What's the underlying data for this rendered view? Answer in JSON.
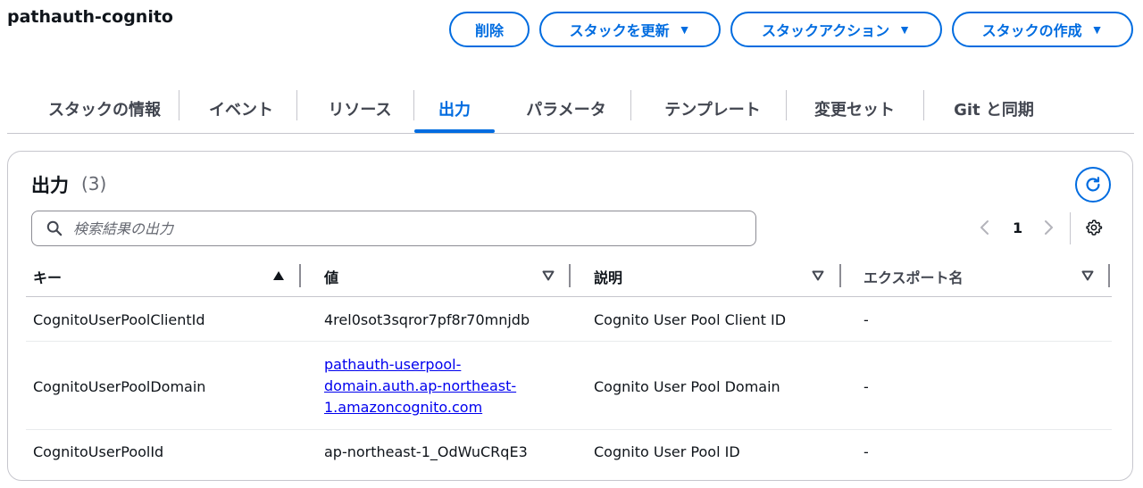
{
  "stack_name": "pathauth-cognito",
  "actions": {
    "delete": "削除",
    "update": "スタックを更新",
    "stack_actions": "スタックアクション",
    "create": "スタックの作成",
    "caret": "▼"
  },
  "tabs": [
    {
      "label": "スタックの情報"
    },
    {
      "label": "イベント"
    },
    {
      "label": "リソース"
    },
    {
      "label": "出力",
      "active": true
    },
    {
      "label": "パラメータ"
    },
    {
      "label": "テンプレート"
    },
    {
      "label": "変更セット"
    },
    {
      "label": "Git と同期"
    }
  ],
  "outputs": {
    "title": "出力",
    "count": "(3)",
    "search_placeholder": "検索結果の出力",
    "page": "1",
    "columns": [
      "キー",
      "値",
      "説明",
      "エクスポート名"
    ],
    "rows": [
      {
        "key": "CognitoUserPoolClientId",
        "value": "4rel0sot3sqror7pf8r70mnjdb",
        "value_is_link": false,
        "description": "Cognito User Pool Client ID",
        "export": "-"
      },
      {
        "key": "CognitoUserPoolDomain",
        "value": "pathauth-userpool-domain.auth.ap-northeast-1.amazoncognito.com",
        "value_lines": [
          "pathauth-userpool-",
          "domain.auth.ap-northeast-",
          "1.amazoncognito.com"
        ],
        "value_is_link": true,
        "description": "Cognito User Pool Domain",
        "export": "-"
      },
      {
        "key": "CognitoUserPoolId",
        "value": "ap-northeast-1_OdWuCRqE3",
        "value_is_link": false,
        "description": "Cognito User Pool ID",
        "export": "-"
      }
    ]
  },
  "icons": {
    "search": "search-icon",
    "refresh": "refresh-icon",
    "settings": "gear-icon",
    "sort_asc": "caret-up-filled-icon",
    "sort_desc": "caret-down-outline-icon",
    "prev": "chevron-left-icon",
    "next": "chevron-right-icon"
  },
  "colors": {
    "accent": "#006ce0",
    "text": "#0f141a",
    "muted": "#656871",
    "link": "#0000ee",
    "border": "#c6c6cd"
  }
}
